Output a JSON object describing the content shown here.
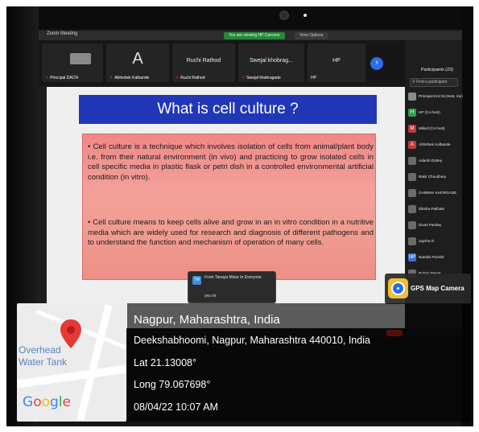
{
  "zoom": {
    "window_title": "Zoom Meeting",
    "view_pill": "You are viewing HP Carcano",
    "view_options": "View Options"
  },
  "thumbnails": [
    {
      "big": "",
      "name": "Principal DACN"
    },
    {
      "big": "A",
      "name": "Abhishek Kalbande"
    },
    {
      "big": "Ruchi Rathod",
      "name": "Ruchi Rathod"
    },
    {
      "big": "Swejal  khobrag...",
      "name": "Swejal khobragade"
    },
    {
      "big": "HP",
      "name": "HP"
    }
  ],
  "slide": {
    "title": "What is cell culture ?",
    "para1": "• Cell culture is a technique which involves isolation of cells from animal/plant body i.e. from their natural environment (in vivo) and practicing to grow isolated cells in cell specific media in plastic flask or petri dish in a controlled environmental artificial condition (in vitro).",
    "para2": "• Cell culture means to keep cells alive and grow in an  in vitro condition in a nutritive media which are widely used for research and diagnosis of different pathogens and to understand the function and mechanism of operation of many cells."
  },
  "participants": {
    "title": "Participants (23)",
    "search_placeholder": "Find a participant",
    "list": [
      {
        "initials": "",
        "name": "Principal DACN (Host, me)",
        "color": "#8c8c8c"
      },
      {
        "initials": "H",
        "name": "HP (Co-host)",
        "color": "#2e9e4f"
      },
      {
        "initials": "M",
        "name": "Milind (Co-host)",
        "color": "#c03a3a"
      },
      {
        "initials": "A",
        "name": "Abhishek Kalbande",
        "color": "#c03a3a"
      },
      {
        "initials": "",
        "name": "Adarsh Dubey",
        "color": "#6a6a6a"
      },
      {
        "initials": "",
        "name": "Bakir Choudhary",
        "color": "#6a6a6a"
      },
      {
        "initials": "",
        "name": "CHINMAI KHORGADE",
        "color": "#6a6a6a"
      },
      {
        "initials": "",
        "name": "Diksha Pakhale",
        "color": "#6a6a6a"
      },
      {
        "initials": "",
        "name": "Divas Pandey",
        "color": "#6a6a6a"
      },
      {
        "initials": "",
        "name": "Jaysha D",
        "color": "#6a6a6a"
      },
      {
        "initials": "NP",
        "name": "Nandini Purohit",
        "color": "#3a6fd0"
      },
      {
        "initials": "",
        "name": "Rohan Pawar",
        "color": "#6a6a6a"
      }
    ]
  },
  "chat": {
    "avatar": "TM",
    "from": "From Tanaya Misar to Everyone",
    "message": "yes sir"
  },
  "gps_badge": {
    "label": "GPS Map Camera"
  },
  "location": {
    "city": "Nagpur, Maharashtra, India",
    "address": "Deekshabhoomi, Nagpur, Maharashtra 440010, India",
    "lat": "Lat 21.13008°",
    "long": "Long 79.067698°",
    "datetime": "08/04/22 10:07 AM"
  },
  "map": {
    "label_line1": "Overhead",
    "label_line2": "Water Tank",
    "google_letters": [
      {
        "ch": "G",
        "color": "#4285f4"
      },
      {
        "ch": "o",
        "color": "#ea4335"
      },
      {
        "ch": "o",
        "color": "#fbbc05"
      },
      {
        "ch": "g",
        "color": "#4285f4"
      },
      {
        "ch": "l",
        "color": "#34a853"
      },
      {
        "ch": "e",
        "color": "#ea4335"
      }
    ]
  }
}
